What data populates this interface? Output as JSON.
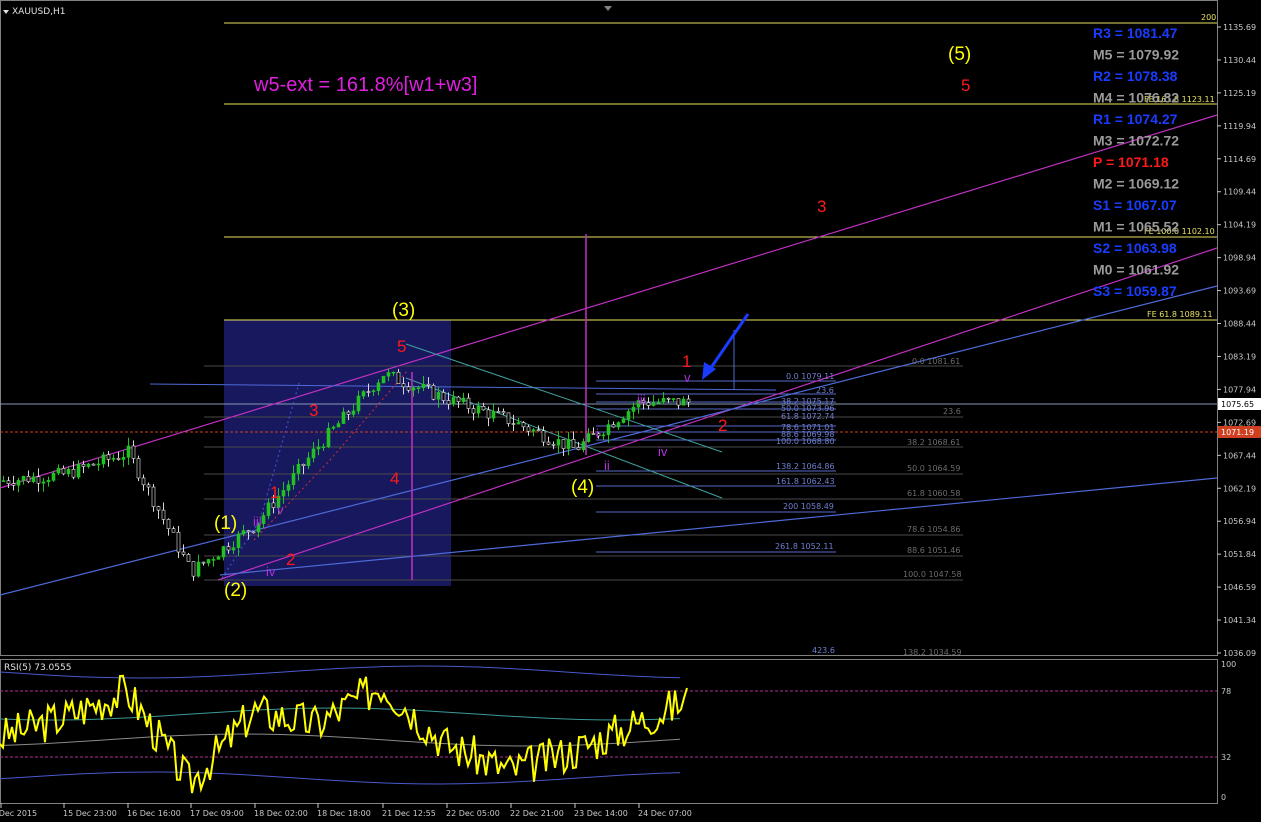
{
  "symbol_label": "XAUUSD,H1",
  "annotation": "w5-ext = 161.8%[w1+w3]",
  "price_axis": {
    "ticks": [
      "1135.69",
      "1130.44",
      "1125.19",
      "1119.94",
      "1114.69",
      "1109.44",
      "1104.19",
      "1098.94",
      "1093.69",
      "1088.44",
      "1083.19",
      "1077.94",
      "1072.69",
      "1067.44",
      "1062.19",
      "1056.94",
      "1051.84",
      "1046.59",
      "1041.34",
      "1036.09"
    ],
    "current_price": "1075.65",
    "bid_line": "1071.19"
  },
  "time_axis": [
    "15 Dec 2015",
    "15 Dec 23:00",
    "16 Dec 16:00",
    "17 Dec 09:00",
    "18 Dec 02:00",
    "18 Dec 18:00",
    "21 Dec 12:55",
    "22 Dec 05:00",
    "22 Dec 21:00",
    "23 Dec 14:00",
    "24 Dec 07:00"
  ],
  "pivots": [
    {
      "label": "R3 = 1081.47",
      "color": "#1a3cff"
    },
    {
      "label": "M5 = 1079.92",
      "color": "#9a9a9a"
    },
    {
      "label": "R2 = 1078.38",
      "color": "#1a3cff"
    },
    {
      "label": "M4 = 1076.82",
      "color": "#9a9a9a"
    },
    {
      "label": "R1 = 1074.27",
      "color": "#1a3cff"
    },
    {
      "label": "M3 = 1072.72",
      "color": "#9a9a9a"
    },
    {
      "label": "P   = 1071.18",
      "color": "#ff1a1a"
    },
    {
      "label": "M2 = 1069.12",
      "color": "#9a9a9a"
    },
    {
      "label": "S1 = 1067.07",
      "color": "#1a3cff"
    },
    {
      "label": "M1 = 1065.52",
      "color": "#9a9a9a"
    },
    {
      "label": "S2 = 1063.98",
      "color": "#1a3cff"
    },
    {
      "label": "M0 = 1061.92",
      "color": "#9a9a9a"
    },
    {
      "label": "S3 = 1059.87",
      "color": "#1a3cff"
    }
  ],
  "fib_expansion": {
    "fe_200": "200",
    "fe_161": "FE 161.8 1123.11",
    "fe_100": "FE 100.0 1102.10",
    "fe_61": "FE 61.8 1089.11"
  },
  "fib_retracement_1": [
    "0.0 1079.11",
    "23.6",
    "38.2 1075.17",
    "50.0 1073.96",
    "61.8 1072.74",
    "78.6 1071.01",
    "88.6 1069.98",
    "100.0 1068.80",
    "138.2 1064.86",
    "161.8 1062.43",
    "200 1058.49",
    "261.8 1052.11",
    "423.6"
  ],
  "fib_retracement_2": [
    "0.0 1081.61",
    "23.6",
    "38.2 1068.61",
    "50.0 1064.59",
    "61.8 1060.58",
    "78.6 1054.86",
    "88.6 1051.46",
    "100.0 1047.58",
    "138.2 1034.59"
  ],
  "wave_labels_major": [
    "(1)",
    "(2)",
    "(3)",
    "(4)",
    "(5)"
  ],
  "wave_labels_red": [
    "1",
    "2",
    "3",
    "4",
    "5",
    "1",
    "2",
    "3",
    "5"
  ],
  "wave_labels_minor": [
    "iii",
    "iv",
    "ii",
    "iii",
    "iv",
    "v",
    "v",
    "i"
  ],
  "rsi": {
    "label": "RSI(5) 73.0555",
    "ticks": [
      "100",
      "78",
      "32",
      "0"
    ],
    "last": 73.0555
  },
  "chart_data": [
    {
      "type": "line",
      "title": "XAUUSD,H1",
      "xlabel": "",
      "ylabel": "",
      "ylim": [
        1036.09,
        1138.0
      ],
      "x": [
        "15 Dec 2015",
        "15 Dec 23:00",
        "16 Dec 16:00",
        "17 Dec 09:00",
        "18 Dec 02:00",
        "18 Dec 18:00",
        "21 Dec 12:55",
        "22 Dec 05:00",
        "22 Dec 21:00",
        "23 Dec 14:00",
        "24 Dec 07:00"
      ],
      "series": [
        {
          "name": "XAUUSD,H1",
          "values": [
            1063.5,
            1064.5,
            1068.0,
            1049.0,
            1056.5,
            1069.0,
            1080.5,
            1076.5,
            1073.0,
            1068.5,
            1076.0
          ]
        }
      ]
    },
    {
      "type": "line",
      "title": "RSI(5) 73.0555",
      "ylim": [
        0,
        100
      ],
      "x": [
        "15 Dec 2015",
        "15 Dec 23:00",
        "16 Dec 16:00",
        "17 Dec 09:00",
        "18 Dec 02:00",
        "18 Dec 18:00",
        "21 Dec 12:55",
        "22 Dec 05:00",
        "22 Dec 21:00",
        "23 Dec 14:00",
        "24 Dec 07:00"
      ],
      "series": [
        {
          "name": "RSI(5) 73.0555",
          "values": [
            45,
            60,
            80,
            10,
            65,
            55,
            85,
            40,
            20,
            35,
            73.0555
          ]
        }
      ]
    }
  ]
}
